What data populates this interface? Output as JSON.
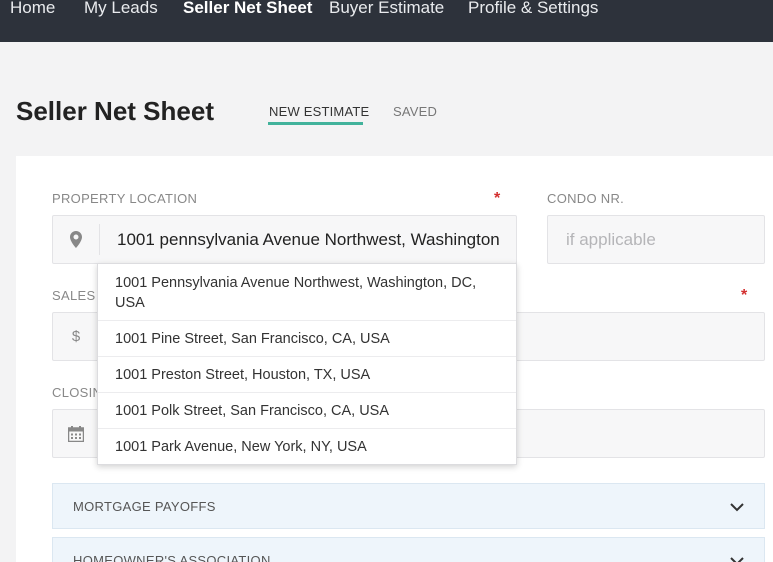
{
  "nav": {
    "items": [
      {
        "label": "Home"
      },
      {
        "label": "My Leads"
      },
      {
        "label": "Seller Net Sheet"
      },
      {
        "label": "Buyer Estimate"
      },
      {
        "label": "Profile & Settings"
      }
    ]
  },
  "page": {
    "title": "Seller Net Sheet",
    "tabs": [
      {
        "label": "NEW ESTIMATE"
      },
      {
        "label": "SAVED"
      }
    ]
  },
  "form": {
    "property_location": {
      "label": "PROPERTY LOCATION",
      "required_mark": "*",
      "value": "1001 pennsylvania Avenue Northwest, Washington"
    },
    "condo": {
      "label": "CONDO NR.",
      "placeholder": "if applicable"
    },
    "sales_price": {
      "label": "SALES",
      "required_mark": "*",
      "currency_symbol": "$"
    },
    "closing_date": {
      "label": "CLOSIN",
      "icon": "calendar-icon"
    }
  },
  "suggestions": [
    "1001 Pennsylvania Avenue Northwest, Washington, DC, USA",
    "1001 Pine Street, San Francisco, CA, USA",
    "1001 Preston Street, Houston, TX, USA",
    "1001 Polk Street, San Francisco, CA, USA",
    "1001 Park Avenue, New York, NY, USA"
  ],
  "sections": [
    {
      "title": "MORTGAGE PAYOFFS"
    },
    {
      "title": "HOMEOWNER'S ASSOCIATION"
    }
  ],
  "colors": {
    "nav_bg": "#2d323b",
    "accent": "#41b29b",
    "required": "#d32f2f"
  }
}
